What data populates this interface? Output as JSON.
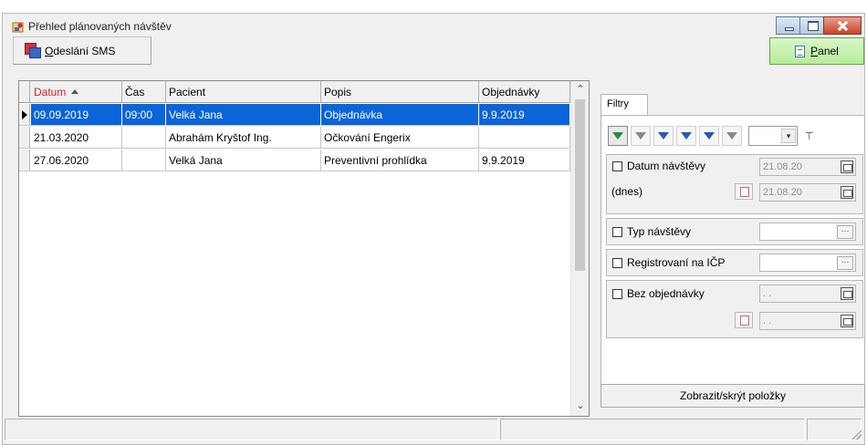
{
  "window": {
    "title": "Přehled plánovaných návštěv",
    "icon": "calendar-person-icon"
  },
  "toolbar": {
    "sms_button_label": "Odeslání SMS",
    "sms_icon": "sms-envelope-icon"
  },
  "panel_button": {
    "label": "Panel",
    "icon": "document-icon",
    "color": "#b7eb9b"
  },
  "grid": {
    "columns": [
      "Datum",
      "Čas",
      "Pacient",
      "Popis",
      "Objednávky"
    ],
    "sorted_column": "Datum",
    "sort_direction": "ascending",
    "rows": [
      {
        "datum": "09.09.2019",
        "cas": "09:00",
        "pacient": "Velká Jana",
        "popis": "Objednávka",
        "objednavky": "9.9.2019",
        "selected": true
      },
      {
        "datum": "21.03.2020",
        "cas": "",
        "pacient": "Abrahám Kryštof Ing.",
        "popis": "Očkování Engerix",
        "objednavky": "",
        "selected": false
      },
      {
        "datum": "27.06.2020",
        "cas": "",
        "pacient": "Velká Jana",
        "popis": "Preventivní prohlídka",
        "objednavky": "9.9.2019",
        "selected": false
      }
    ],
    "selection_color": "#0b64d8"
  },
  "filters": {
    "tab_label": "Filtry",
    "datum_navstevy": {
      "label": "Datum návštěvy",
      "checked": false,
      "from": "21.08.20",
      "to": "21.08.20",
      "today_label": "(dnes)"
    },
    "typ_navstevy": {
      "label": "Typ návštěvy",
      "checked": false,
      "value": ""
    },
    "registrovani": {
      "label": "Registrovaní na IČP",
      "checked": false,
      "value": ""
    },
    "bez_objednavky": {
      "label": "Bez objednávky",
      "checked": false,
      "from": ". .",
      "to": ". ."
    },
    "toggle_label": "Zobrazit/skrýt položky"
  }
}
